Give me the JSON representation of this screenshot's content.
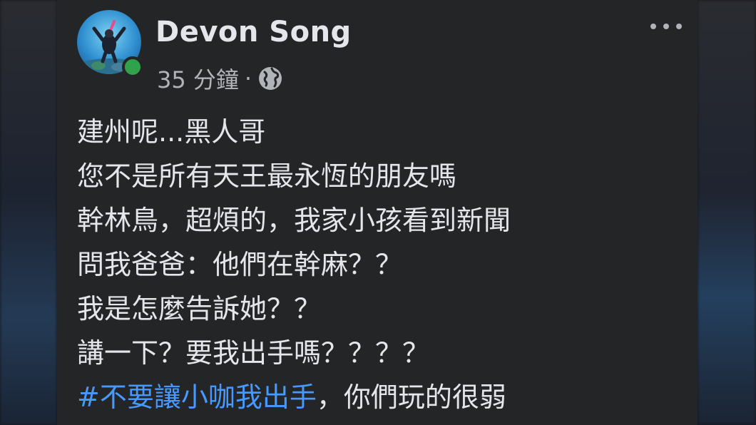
{
  "post": {
    "author": "Devon Song",
    "time": "35 分鐘",
    "separator": "·",
    "privacy_icon": "globe-icon",
    "menu_icon": "more-icon",
    "lines": [
      "建州呢...黑人哥",
      "您不是所有天王最永恆的朋友嗎",
      "幹林鳥，超煩的，我家小孩看到新聞",
      "問我爸爸：他們在幹麻？？",
      "我是怎麼告訴她？？",
      "講一下？要我出手嗎？？？？"
    ],
    "hashtag": "#不要讓小咖我出手",
    "after_hashtag": "，你們玩的很弱"
  },
  "colors": {
    "background": "#242526",
    "text": "#e4e6eb",
    "secondary_text": "#b0b3b8",
    "hashtag": "#4599ff",
    "online": "#31a24c"
  }
}
